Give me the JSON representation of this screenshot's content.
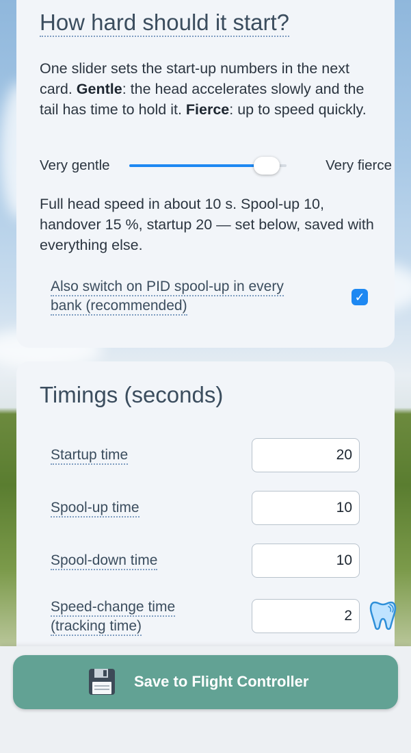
{
  "spool_card": {
    "title": "How hard should it start?",
    "intro_pre": "One slider sets the start-up numbers in the next card. ",
    "intro_gentle": "Gentle",
    "intro_mid": ": the head accelerates slowly and the tail has time to hold it. ",
    "intro_fierce": "Fierce",
    "intro_post": ": up to speed quickly.",
    "slider": {
      "min_label": "Very gentle",
      "max_label": "Very fierce",
      "value_fraction": 0.95
    },
    "summary": "Full head speed in about 10 s. Spool-up 10, handover 15 %, startup 20 — set below, saved with everything else.",
    "pid_checkbox": {
      "label": "Also switch on PID spool-up in every bank (recommended)",
      "checked": true
    }
  },
  "timings_card": {
    "title": "Timings (seconds)",
    "rows": [
      {
        "label": "Startup time",
        "value": "20"
      },
      {
        "label": "Spool-up time",
        "value": "10"
      },
      {
        "label": "Spool-down time",
        "value": "10"
      },
      {
        "label_line1": "Speed-change time",
        "label_line2": "(tracking time)",
        "value": "2"
      }
    ]
  },
  "footer": {
    "save_label": "Save to Flight Controller",
    "save_icon": "floppy-disk-icon"
  },
  "floating_icon": "tooth-icon",
  "colors": {
    "accent": "#1e88f2",
    "save_button": "#62a294",
    "heading": "#3b4d5e"
  }
}
